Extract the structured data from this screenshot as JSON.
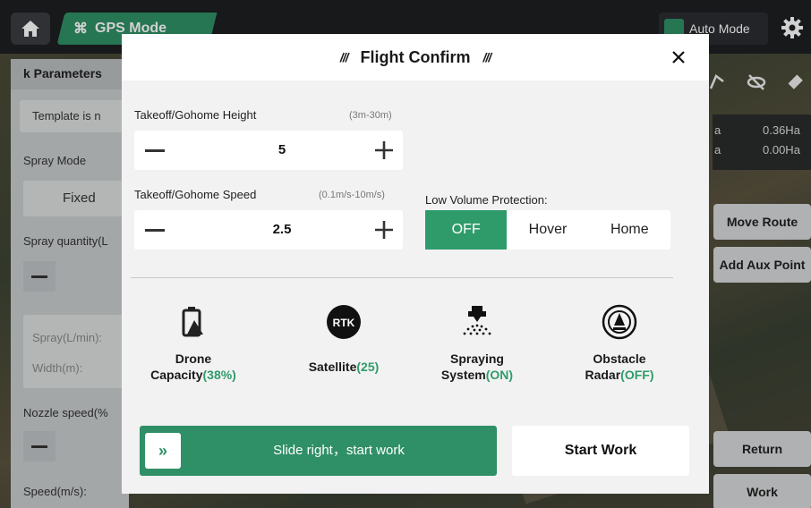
{
  "app": {
    "mode_label": "GPS Mode",
    "auto_mode_label": "Auto Mode"
  },
  "left_panel": {
    "header": "k Parameters",
    "template_text": "Template is n",
    "spray_mode_label": "Spray Mode",
    "spray_mode_value": "Fixed",
    "spray_quantity_label": "Spray quantity(L",
    "spray_rate_label": "Spray(L/min):",
    "width_label": "Width(m):",
    "nozzle_speed_label": "Nozzle speed(%",
    "speed_label": "Speed(m/s):"
  },
  "right_panel": {
    "area_1": "0.36Ha",
    "area_2": "0.00Ha",
    "area_1_prefix": "a",
    "area_2_prefix": "a",
    "move_route": "Move Route",
    "add_aux_point": "Add Aux Point",
    "return": "Return",
    "work": "Work"
  },
  "dialog": {
    "title": "Flight Confirm",
    "slashes": "///",
    "takeoff_height": {
      "label": "Takeoff/Gohome Height",
      "range": "(3m-30m)",
      "value": "5"
    },
    "takeoff_speed": {
      "label": "Takeoff/Gohome Speed",
      "range": "(0.1m/s-10m/s)",
      "value": "2.5"
    },
    "low_volume": {
      "label": "Low Volume Protection:",
      "options": [
        "OFF",
        "Hover",
        "Home"
      ],
      "selected": "OFF"
    },
    "status": {
      "drone_capacity": {
        "line1": "Drone",
        "line2": "Capacity",
        "value": "(38%)"
      },
      "satellite": {
        "label": "Satellite",
        "value": "(25)",
        "icon_text": "RTK"
      },
      "spraying": {
        "line1": "Spraying",
        "line2": "System",
        "value": "(ON)"
      },
      "radar": {
        "line1": "Obstacle",
        "line2": "Radar",
        "value": "(OFF)"
      }
    },
    "slide_text": "Slide right，start work",
    "slide_knob": "»",
    "start_work": "Start Work"
  },
  "colors": {
    "accent": "#2f9b6b",
    "topbar": "#1d1f22"
  }
}
